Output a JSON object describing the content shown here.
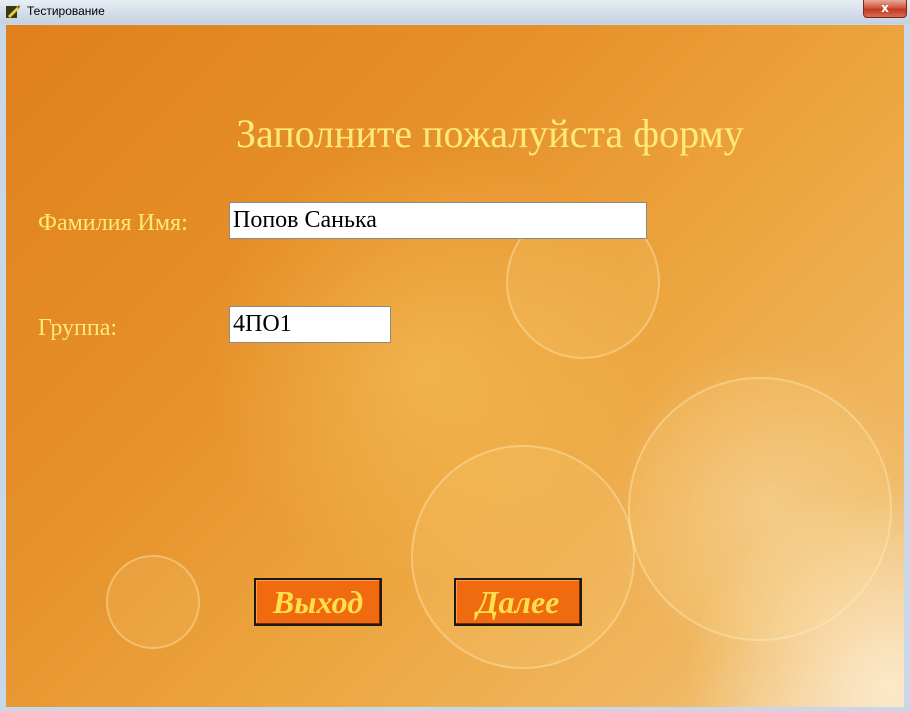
{
  "window": {
    "title": "Тестирование",
    "close_label": "x"
  },
  "form": {
    "heading": "Заполните пожалуйста форму",
    "name_label": "Фамилия Имя:",
    "name_value": "Попов Санька",
    "group_label": "Группа:",
    "group_value": "4ПО1"
  },
  "buttons": {
    "exit_label": "Выход",
    "next_label": "Далее"
  },
  "colors": {
    "label_text": "#ffe97a",
    "button_fill": "#f06a10",
    "button_text": "#ffe04a",
    "background_orange": "#e6912a"
  }
}
